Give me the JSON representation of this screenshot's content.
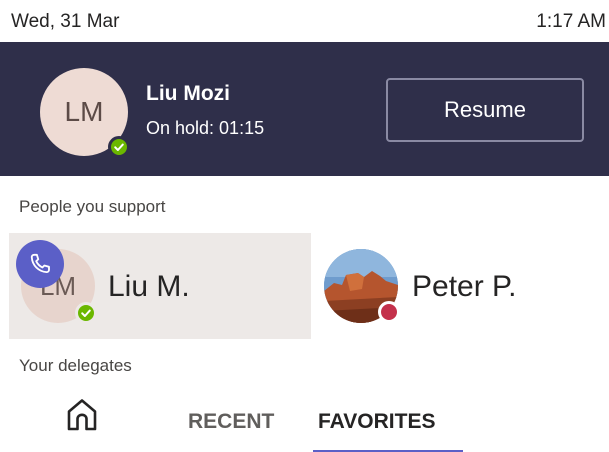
{
  "status_bar": {
    "date": "Wed, 31 Mar",
    "time": "1:17 AM"
  },
  "hold_banner": {
    "avatar_initials": "LM",
    "name": "Liu Mozi",
    "status": "On hold: 01:15",
    "resume_label": "Resume",
    "presence": "available"
  },
  "sections": {
    "people_you_support": "People you support",
    "your_delegates": "Your delegates"
  },
  "people": [
    {
      "initials": "LM",
      "name": "Liu M.",
      "presence": "available",
      "on_call": true
    },
    {
      "initials": "",
      "name": "Peter P.",
      "presence": "busy",
      "on_call": false
    }
  ],
  "nav": {
    "home_icon": "home-icon",
    "tabs": [
      {
        "label": "RECENT",
        "selected": false
      },
      {
        "label": "FAVORITES",
        "selected": true
      }
    ]
  },
  "colors": {
    "banner": "#2f2f4a",
    "accent": "#5b5fc7",
    "available": "#6bb700",
    "busy": "#c4314b",
    "selected_tile": "#ede9e7"
  }
}
